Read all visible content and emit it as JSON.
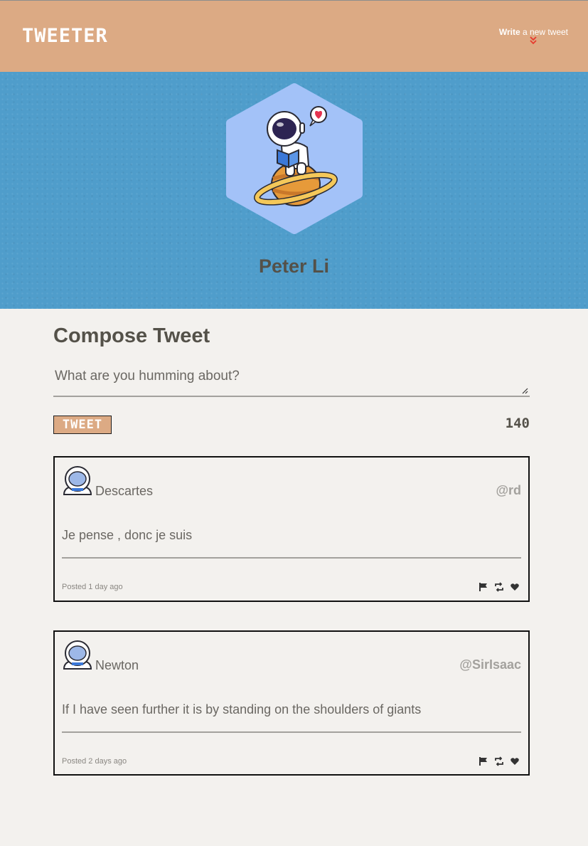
{
  "nav": {
    "brand": "TWEETER",
    "write_bold": "Write",
    "write_rest": " a new tweet",
    "chevron_icon": "double-chevron-down-icon",
    "chevron_color": "#e73a2e"
  },
  "profile": {
    "name": "Peter Li",
    "avatar": "astronaut-on-planet-avatar"
  },
  "compose": {
    "title": "Compose Tweet",
    "placeholder": "What are you humming about?",
    "button_label": "TWEET",
    "counter": "140"
  },
  "tweets": [
    {
      "name": "Descartes",
      "handle": "@rd",
      "text": "Je pense , donc je suis",
      "time": "Posted 1 day ago",
      "actions": [
        "flag-icon",
        "retweet-icon",
        "heart-icon"
      ]
    },
    {
      "name": "Newton",
      "handle": "@SirIsaac",
      "text": "If I have seen further it is by standing on the shoulders of giants",
      "time": "Posted 2 days ago",
      "actions": [
        "flag-icon",
        "retweet-icon",
        "heart-icon"
      ]
    }
  ],
  "colors": {
    "header": "#dcaa84",
    "hero": "#4f9dcb",
    "avatar_bg": "#a3c2f8",
    "page": "#f3f1ee",
    "text": "#545149"
  }
}
